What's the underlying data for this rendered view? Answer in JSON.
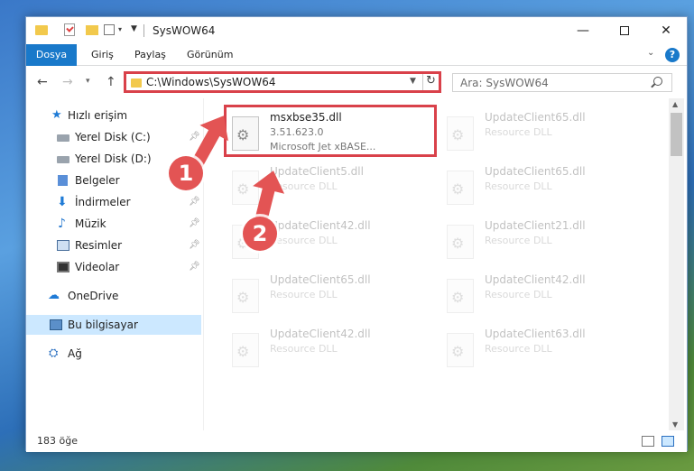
{
  "window": {
    "title": "SysWOW64",
    "minimize": "—",
    "close": "✕"
  },
  "ribbon": {
    "tabs": [
      "Dosya",
      "Giriş",
      "Paylaş",
      "Görünüm"
    ],
    "help": "?"
  },
  "address": {
    "path": "C:\\Windows\\SysWOW64",
    "search_placeholder": "Ara: SysWOW64"
  },
  "navpane": {
    "items": [
      {
        "label": "Hızlı erişim",
        "pinned": false
      },
      {
        "label": "Yerel Disk (C:)",
        "pinned": true
      },
      {
        "label": "Yerel Disk (D:)",
        "pinned": false
      },
      {
        "label": "Belgeler",
        "pinned": true
      },
      {
        "label": "İndirmeler",
        "pinned": true
      },
      {
        "label": "Müzik",
        "pinned": true
      },
      {
        "label": "Resimler",
        "pinned": true
      },
      {
        "label": "Videolar",
        "pinned": true
      },
      {
        "label": "OneDrive",
        "pinned": false
      },
      {
        "label": "Bu bilgisayar",
        "pinned": false,
        "selected": true
      },
      {
        "label": "Ağ",
        "pinned": false
      }
    ]
  },
  "files": [
    {
      "name": "msxbse35.dll",
      "line1": "3.51.623.0",
      "line2": "Microsoft Jet xBASE...",
      "highlighted": true
    },
    {
      "name": "UpdateClient65.dll",
      "line1": "Resource DLL",
      "line2": ""
    },
    {
      "name": "UpdateClient5.dll",
      "line1": "Resource DLL",
      "line2": ""
    },
    {
      "name": "UpdateClient65.dll",
      "line1": "Resource DLL",
      "line2": ""
    },
    {
      "name": "UpdateClient42.dll",
      "line1": "Resource DLL",
      "line2": ""
    },
    {
      "name": "UpdateClient21.dll",
      "line1": "Resource DLL",
      "line2": ""
    },
    {
      "name": "UpdateClient65.dll",
      "line1": "Resource DLL",
      "line2": ""
    },
    {
      "name": "UpdateClient42.dll",
      "line1": "Resource DLL",
      "line2": ""
    },
    {
      "name": "UpdateClient42.dll",
      "line1": "Resource DLL",
      "line2": ""
    },
    {
      "name": "UpdateClient63.dll",
      "line1": "Resource DLL",
      "line2": ""
    }
  ],
  "status": {
    "count_text": "183 öğe"
  },
  "annotations": {
    "step1": "1",
    "step2": "2",
    "color": "#e35454"
  }
}
